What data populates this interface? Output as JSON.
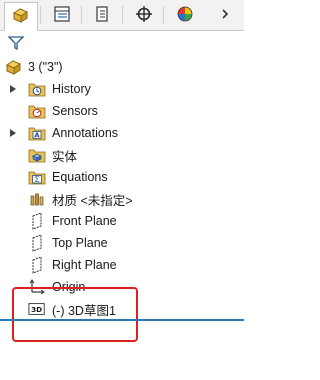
{
  "tabs": [
    {
      "name": "feature-manager",
      "icon": "feature-manager-icon"
    },
    {
      "name": "property-manager",
      "icon": "property-manager-icon"
    },
    {
      "name": "configuration-manager",
      "icon": "configuration-manager-icon"
    },
    {
      "name": "dimxpert-manager",
      "icon": "crosshair-icon"
    },
    {
      "name": "display-manager",
      "icon": "appearance-icon"
    }
  ],
  "tree": {
    "root_label": "3 (\"3\")",
    "items": [
      {
        "label": "History",
        "icon": "history-folder-icon",
        "expandable": true
      },
      {
        "label": "Sensors",
        "icon": "sensors-folder-icon",
        "expandable": false
      },
      {
        "label": "Annotations",
        "icon": "annotations-folder-icon",
        "expandable": true
      },
      {
        "label": "实体",
        "icon": "solid-bodies-folder-icon",
        "expandable": false
      },
      {
        "label": "Equations",
        "icon": "equations-folder-icon",
        "expandable": false
      },
      {
        "label": "材质 <未指定>",
        "icon": "material-icon",
        "expandable": false
      },
      {
        "label": "Front Plane",
        "icon": "plane-icon",
        "expandable": false
      },
      {
        "label": "Top Plane",
        "icon": "plane-icon",
        "expandable": false
      },
      {
        "label": "Right Plane",
        "icon": "plane-icon",
        "expandable": false
      },
      {
        "label": "Origin",
        "icon": "origin-icon",
        "expandable": false
      },
      {
        "label": "(-) 3D草图1",
        "icon": "3d-sketch-icon",
        "expandable": false
      }
    ]
  },
  "colors": {
    "folder": "#e8c25a",
    "accent_blue": "#2a78b8",
    "highlight_red": "#e02020"
  }
}
